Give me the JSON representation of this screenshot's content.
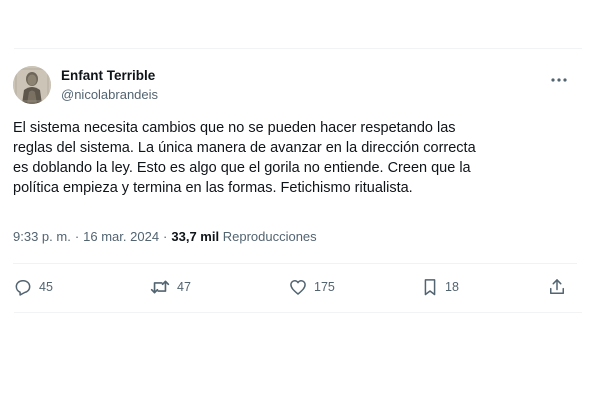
{
  "author": {
    "display_name": "Enfant Terrible",
    "handle": "@nicolabrandeis",
    "avatar_icon": "portrait-avatar"
  },
  "more_icon": "more-horizontal-icon",
  "tweet": {
    "text_lines": [
      "El sistema necesita cambios que no se pueden hacer respetando las",
      "reglas del sistema. La única manera de avanzar en la dirección correcta",
      "es doblando la ley. Esto es algo que el gorila no entiende. Creen que la",
      "política empieza y termina en las formas. Fetichismo ritualista."
    ],
    "time": "9:33 p. m.",
    "date": "16 mar. 2024",
    "views_count": "33,7 mil",
    "views_label": "Reproducciones"
  },
  "actions": {
    "replies": "45",
    "reposts": "47",
    "likes": "175",
    "bookmarks": "18"
  },
  "colors": {
    "text_primary": "#0f1419",
    "text_secondary": "#536471",
    "divider": "#eff3f4"
  }
}
